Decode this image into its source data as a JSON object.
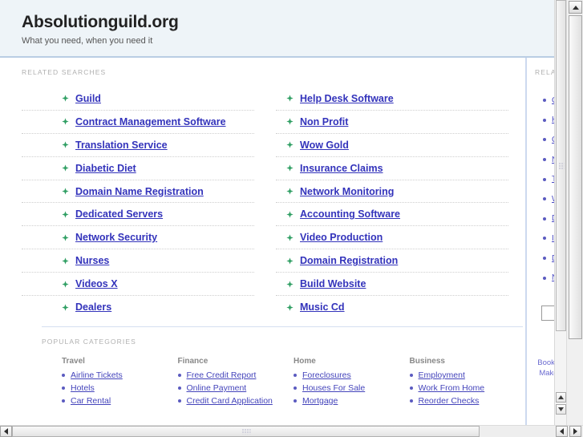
{
  "header": {
    "title": "Absolutionguild.org",
    "tagline": "What you need, when you need it"
  },
  "colors": {
    "header_bg": "#eef4f8",
    "header_border": "#b9cde4",
    "link": "#3333bb",
    "arrow_bullet": "#2e9e62",
    "section_label": "#b0b0b0",
    "sidebar_divider": "#ccd9ef"
  },
  "related_searches": {
    "label": "RELATED SEARCHES",
    "left_column": [
      {
        "label": "Guild"
      },
      {
        "label": "Contract Management Software"
      },
      {
        "label": "Translation Service"
      },
      {
        "label": "Diabetic Diet"
      },
      {
        "label": "Domain Name Registration"
      },
      {
        "label": "Dedicated Servers"
      },
      {
        "label": "Network Security"
      },
      {
        "label": "Nurses"
      },
      {
        "label": "Videos X"
      },
      {
        "label": "Dealers"
      }
    ],
    "right_column": [
      {
        "label": "Help Desk Software"
      },
      {
        "label": "Non Profit"
      },
      {
        "label": "Wow Gold"
      },
      {
        "label": "Insurance Claims"
      },
      {
        "label": "Network Monitoring"
      },
      {
        "label": "Accounting Software"
      },
      {
        "label": "Video Production"
      },
      {
        "label": "Domain Registration"
      },
      {
        "label": "Build Website"
      },
      {
        "label": "Music Cd"
      }
    ]
  },
  "popular_categories": {
    "label": "POPULAR CATEGORIES",
    "columns": [
      {
        "heading": "Travel",
        "items": [
          {
            "label": "Airline Tickets"
          },
          {
            "label": "Hotels"
          },
          {
            "label": "Car Rental"
          }
        ]
      },
      {
        "heading": "Finance",
        "items": [
          {
            "label": "Free Credit Report"
          },
          {
            "label": "Online Payment"
          },
          {
            "label": "Credit Card Application"
          }
        ]
      },
      {
        "heading": "Home",
        "items": [
          {
            "label": "Foreclosures"
          },
          {
            "label": "Houses For Sale"
          },
          {
            "label": "Mortgage"
          }
        ]
      },
      {
        "heading": "Business",
        "items": [
          {
            "label": "Employment"
          },
          {
            "label": "Work From Home"
          },
          {
            "label": "Reorder Checks"
          }
        ]
      }
    ]
  },
  "sidebar": {
    "label": "RELATED",
    "items": [
      {
        "label": "Guild"
      },
      {
        "label": "Help Desk Software"
      },
      {
        "label": "Contract Management Software"
      },
      {
        "label": "Non Profit"
      },
      {
        "label": "Translation Service"
      },
      {
        "label": "Wow Gold"
      },
      {
        "label": "Diabetic Diet"
      },
      {
        "label": "Insurance Claims"
      },
      {
        "label": "Domain Name Registration"
      },
      {
        "label": "Network Monitoring"
      }
    ],
    "search": {
      "value": "",
      "placeholder": ""
    },
    "footer_links": [
      {
        "label": "Bookmark"
      },
      {
        "label": "Make this"
      }
    ]
  },
  "scrollbars": {
    "outer_vertical": {
      "position": "top"
    },
    "inner_vertical": {
      "position": "top"
    },
    "horizontal": {
      "position": "left"
    }
  }
}
